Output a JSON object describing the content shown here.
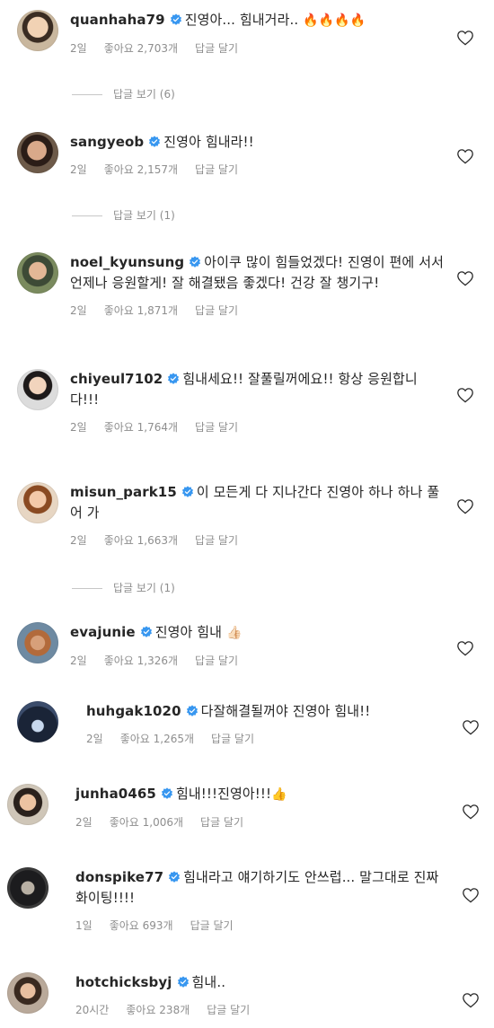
{
  "colors": {
    "text": "#262626",
    "meta": "#8e8e8e",
    "verified": "#3897f0",
    "fire": "#ff6a00",
    "thumb": "#f2c178"
  },
  "icons": {
    "verified": "verified-badge-icon",
    "like": "heart-outline-icon"
  },
  "comments": [
    {
      "username": "quanhaha79",
      "text": "진영아... 힘내거라..",
      "emoji": "🔥🔥🔥🔥",
      "time": "2일",
      "likes": "좋아요 2,703개",
      "reply": "답글 달기",
      "view_replies": "답글 보기 (6)"
    },
    {
      "username": "sangyeob",
      "text": "진영아 힘내라!!",
      "emoji": "",
      "time": "2일",
      "likes": "좋아요 2,157개",
      "reply": "답글 달기",
      "view_replies": "답글 보기 (1)"
    },
    {
      "username": "noel_kyunsung",
      "text": "아이쿠 많이 힘들었겠다! 진영이 편에 서서 언제나 응원할게! 잘 해결됐음 좋겠다! 건강 잘 챙기구!",
      "emoji": "",
      "time": "2일",
      "likes": "좋아요 1,871개",
      "reply": "답글 달기",
      "view_replies": ""
    },
    {
      "username": "chiyeul7102",
      "text": "힘내세요!! 잘풀릴꺼에요!! 항상 응원합니다!!!",
      "emoji": "",
      "time": "2일",
      "likes": "좋아요 1,764개",
      "reply": "답글 달기",
      "view_replies": ""
    },
    {
      "username": "misun_park15",
      "text": "이 모든게 다 지나간다 진영아 하나 하나 풀어 가",
      "emoji": "",
      "time": "2일",
      "likes": "좋아요 1,663개",
      "reply": "답글 달기",
      "view_replies": "답글 보기 (1)"
    },
    {
      "username": "evajunie",
      "text": "진영아 힘내",
      "emoji": "👍🏻",
      "time": "2일",
      "likes": "좋아요 1,326개",
      "reply": "답글 달기",
      "view_replies": ""
    },
    {
      "username": "huhgak1020",
      "text": "다잘해결될꺼야 진영아 힘내!!",
      "emoji": "",
      "time": "2일",
      "likes": "좋아요 1,265개",
      "reply": "답글 달기",
      "view_replies": ""
    },
    {
      "username": "junha0465",
      "text": "힘내!!!진영아!!!",
      "emoji": "👍",
      "time": "2일",
      "likes": "좋아요 1,006개",
      "reply": "답글 달기",
      "view_replies": ""
    },
    {
      "username": "donspike77",
      "text": "힘내라고 얘기하기도 안쓰럽... 말그대로 진짜 화이팅!!!!",
      "emoji": "",
      "time": "1일",
      "likes": "좋아요 693개",
      "reply": "답글 달기",
      "view_replies": ""
    },
    {
      "username": "hotchicksbyj",
      "text": "힘내..",
      "emoji": "",
      "time": "20시간",
      "likes": "좋아요 238개",
      "reply": "답글 달기",
      "view_replies": ""
    }
  ]
}
